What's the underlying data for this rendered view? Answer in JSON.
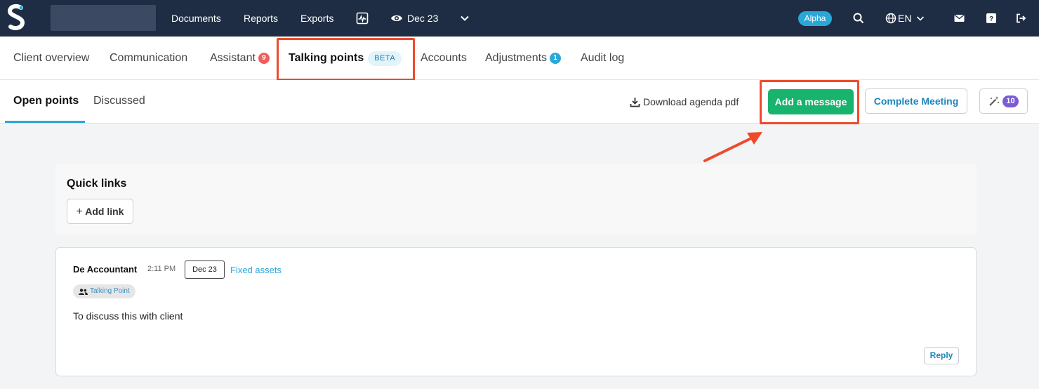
{
  "topbar": {
    "logo_icon": "brand-s-icon",
    "nav": [
      "Documents",
      "Reports",
      "Exports"
    ],
    "activity_icon": "activity-chart-icon",
    "period_label": "Dec 23",
    "eye_icon": "eye-icon",
    "chevron_icon": "chevron-down-icon",
    "alpha_badge": "Alpha",
    "search_icon": "search-icon",
    "language": "EN",
    "globe_icon": "globe-icon",
    "mail_icon": "mail-icon",
    "help_icon": "help-icon",
    "logout_icon": "logout-icon",
    "colors": {
      "bg": "#1f2d44",
      "alpha": "#29a8d8"
    }
  },
  "tabs": {
    "client_overview": "Client overview",
    "communication": "Communication",
    "assistant": "Assistant",
    "assistant_count": "9",
    "talking_points": "Talking points",
    "beta": "BETA",
    "accounts": "Accounts",
    "adjustments": "Adjustments",
    "adjustments_count": "1",
    "audit_log": "Audit log"
  },
  "subtabs": {
    "open_points": "Open points",
    "discussed": "Discussed",
    "download": "Download agenda pdf",
    "add_message": "Add a message",
    "complete_meeting": "Complete Meeting",
    "wand_count": "10"
  },
  "quick_links": {
    "title": "Quick links",
    "add_link": "Add link"
  },
  "message": {
    "author": "De Accountant",
    "time": "2:11 PM",
    "period": "Dec 23",
    "category": "Fixed assets",
    "badge": "Talking Point",
    "text": "To discuss this with client",
    "reply": "Reply"
  },
  "colors": {
    "accent_green": "#18b36c",
    "accent_blue": "#2aa8d8",
    "highlight": "#ef4a2b",
    "badge_red": "#f25c5c",
    "wand_purple": "#7b5cd6"
  }
}
